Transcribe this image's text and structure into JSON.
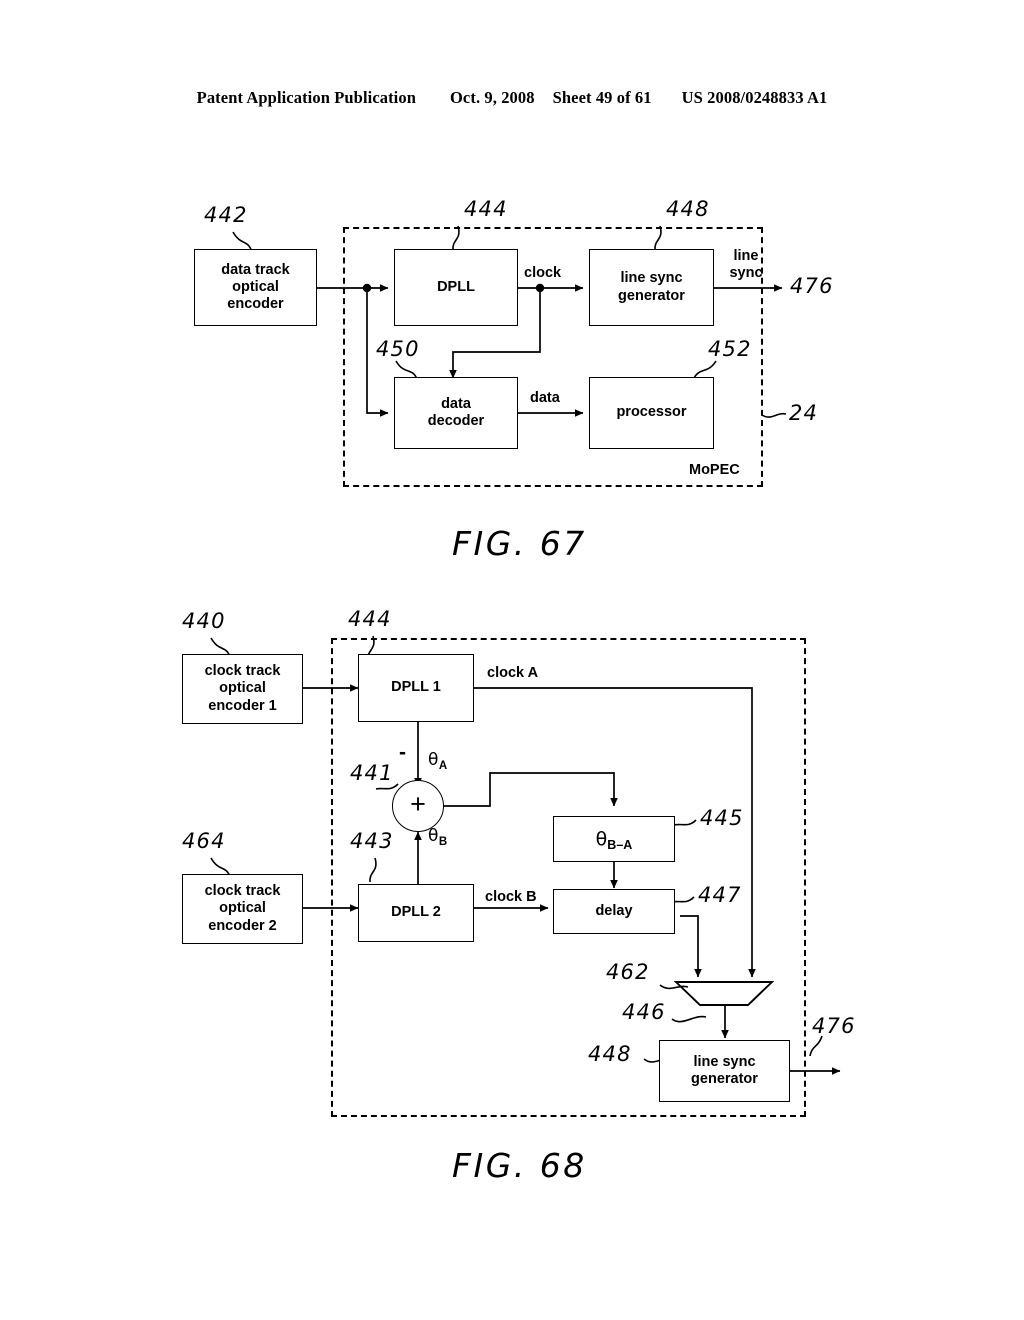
{
  "header": {
    "publication": "Patent Application Publication",
    "date": "Oct. 9, 2008",
    "sheet": "Sheet 49 of 61",
    "patent_number": "US 2008/0248833 A1"
  },
  "fig67": {
    "caption": "FIG. 67",
    "boundary_label": "MoPEC",
    "boundary_ref": "24",
    "blocks": {
      "encoder": "data track\noptical\nencoder",
      "dpll": "DPLL",
      "line_sync_generator": "line sync\ngenerator",
      "data_decoder": "data\ndecoder",
      "processor": "processor"
    },
    "signals": {
      "clock": "clock",
      "line_sync": "line\nsync",
      "data": "data"
    },
    "refs": {
      "encoder": "442",
      "dpll": "444",
      "line_sync_generator": "448",
      "data_decoder": "450",
      "processor": "452",
      "output": "476"
    }
  },
  "fig68": {
    "caption": "FIG. 68",
    "blocks": {
      "encoder1": "clock track\noptical\nencoder 1",
      "encoder2": "clock track\noptical\nencoder 2",
      "dpll1": "DPLL 1",
      "dpll2": "DPLL 2",
      "theta_diff": "θB-A",
      "delay": "delay",
      "line_sync_generator": "line sync\ngenerator",
      "summing_junction": "+"
    },
    "signals": {
      "clock_a": "clock A",
      "clock_b": "clock B",
      "theta_a": "θA",
      "theta_b": "θB",
      "minus": "-"
    },
    "refs": {
      "encoder1": "440",
      "encoder2": "464",
      "dpll1": "444",
      "dpll2": "443",
      "summing_junction": "441",
      "theta_diff": "445",
      "delay": "447",
      "mux": "462",
      "mux_out": "446",
      "line_sync_generator": "448",
      "output": "476"
    }
  }
}
